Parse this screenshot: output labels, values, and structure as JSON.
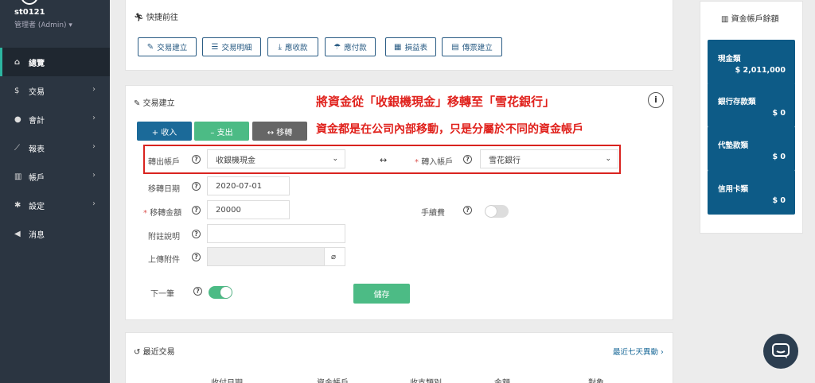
{
  "sidebar": {
    "username": "st0121",
    "role": "管理者 (Admin) ▾",
    "items": [
      {
        "icon": "home-icon",
        "glyph": "⌂",
        "label": "總覽",
        "active": true
      },
      {
        "icon": "dollar-icon",
        "glyph": "$",
        "label": "交易"
      },
      {
        "icon": "user-icon",
        "glyph": "●",
        "label": "會計"
      },
      {
        "icon": "chart-icon",
        "glyph": "⟋",
        "label": "報表"
      },
      {
        "icon": "bank-icon",
        "glyph": "▥",
        "label": "帳戶"
      },
      {
        "icon": "gear-icon",
        "glyph": "✱",
        "label": "設定"
      },
      {
        "icon": "megaphone-icon",
        "glyph": "◀",
        "label": "消息"
      }
    ]
  },
  "quick": {
    "title": "快捷前往",
    "buttons": [
      {
        "glyph": "✎",
        "label": "交易建立"
      },
      {
        "glyph": "☰",
        "label": "交易明細"
      },
      {
        "glyph": "⤓",
        "label": "應收款"
      },
      {
        "glyph": "☂",
        "label": "應付款"
      },
      {
        "glyph": "▦",
        "label": "損益表"
      },
      {
        "glyph": "▤",
        "label": "傳票建立"
      }
    ]
  },
  "tx": {
    "title": "交易建立",
    "annotation_1": "將資金從「收銀機現金」移轉至「雪花銀行」",
    "annotation_2": "資金都是在公司內部移動，只是分屬於不同的資金帳戶",
    "tabs": {
      "income": "+ 收入",
      "expense": "– 支出",
      "transfer": "↔ 移轉"
    },
    "from_label": "轉出帳戶",
    "from_value": "收銀機現金",
    "to_label": "轉入帳戶",
    "to_value": "雪花銀行",
    "date_label": "移轉日期",
    "date_value": "2020-07-01",
    "amount_label": "移轉金額",
    "amount_value": "20000",
    "fee_label": "手續費",
    "note_label": "附註說明",
    "attach_label": "上傳附件",
    "next_label": "下一筆",
    "save": "儲存",
    "required_mark": "*"
  },
  "recent": {
    "title": "最近交易",
    "link": "最近七天異動",
    "columns": [
      "收付日期",
      "資金帳戶",
      "收支類別",
      "金額",
      "對象"
    ]
  },
  "balances": {
    "title": "資金帳戶餘額",
    "accounts": [
      {
        "name": "現金類",
        "value": "$ 2,011,000"
      },
      {
        "name": "銀行存款類",
        "value": "$ 0"
      },
      {
        "name": "代墊款類",
        "value": "$ 0"
      },
      {
        "name": "信用卡類",
        "value": "$ 0"
      }
    ]
  },
  "colors": {
    "sidebar_bg": "#2b3541",
    "primary": "#1b6a99",
    "success": "#4cbb85",
    "annotation": "#e0211c",
    "account_card": "#0d5b87"
  }
}
